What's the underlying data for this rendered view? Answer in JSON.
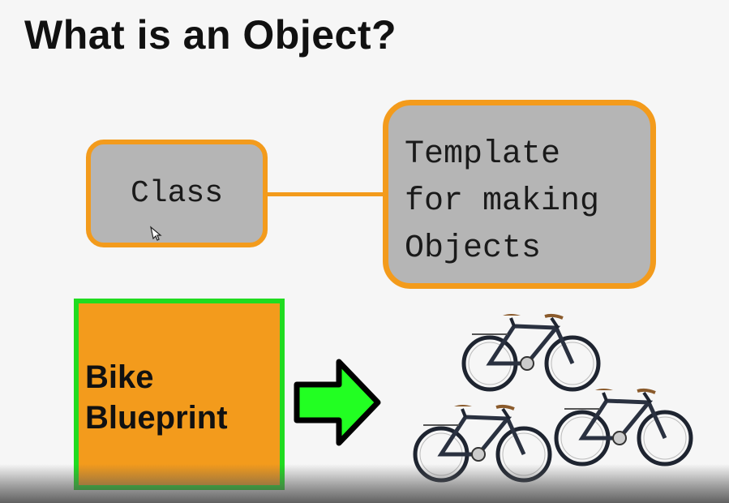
{
  "slide": {
    "title": "What is an Object?",
    "class_box": {
      "label": "Class"
    },
    "template_box": {
      "lines": [
        "Template",
        "for making",
        "Objects"
      ]
    },
    "blueprint": {
      "lines": [
        "Bike",
        "Blueprint"
      ]
    },
    "bikes_count": 3
  },
  "colors": {
    "orange": "#f39b1c",
    "gray_fill": "#b5b5b5",
    "green": "#20dc20",
    "arrow_green": "#22ff22",
    "text": "#111111"
  },
  "icons": [
    "mouse-cursor-icon",
    "right-arrow-icon",
    "bicycle-icon"
  ]
}
